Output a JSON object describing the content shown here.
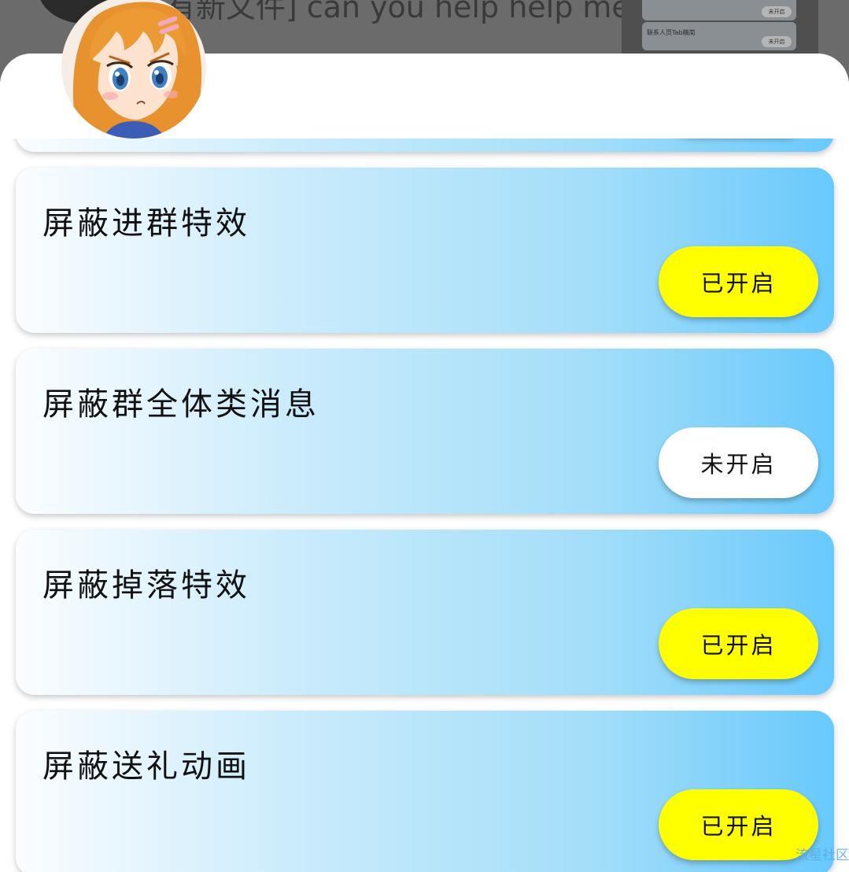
{
  "background": {
    "message_text": "[有新文件] can you help help me? · [动",
    "panel": {
      "row1_label": "",
      "row1_button": "未开启",
      "row2_label": "联系人页Tab精简",
      "row2_button": "未开启"
    }
  },
  "sheet": {
    "cards": [
      {
        "title": "",
        "button_label": "",
        "enabled": true
      },
      {
        "title": "屏蔽进群特效",
        "button_label": "已开启",
        "enabled": true
      },
      {
        "title": "屏蔽群全体类消息",
        "button_label": "未开启",
        "enabled": false
      },
      {
        "title": "屏蔽掉落特效",
        "button_label": "已开启",
        "enabled": true
      },
      {
        "title": "屏蔽送礼动画",
        "button_label": "已开启",
        "enabled": true
      }
    ]
  },
  "colors": {
    "enabled_button": "#ffff00",
    "disabled_button": "#ffffff",
    "card_gradient_end": "#68c9fc"
  },
  "watermark": "流星社区"
}
